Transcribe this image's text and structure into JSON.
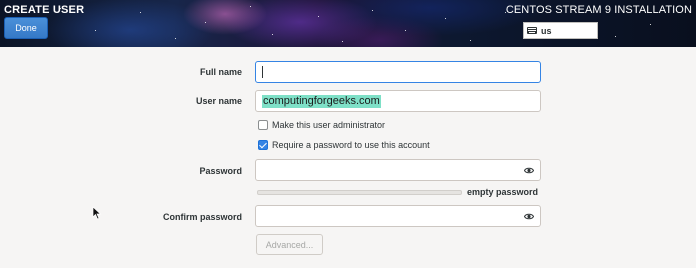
{
  "header": {
    "title": "CREATE USER",
    "done_label": "Done",
    "install_title": "CENTOS STREAM 9 INSTALLATION",
    "keyboard_layout": "us"
  },
  "form": {
    "full_name": {
      "label": "Full name",
      "value": ""
    },
    "user_name": {
      "label": "User name",
      "value": "computingforgeeks.com"
    },
    "admin_checkbox": {
      "label": "Make this user administrator",
      "checked": false
    },
    "require_password_checkbox": {
      "label": "Require a password to use this account",
      "checked": true
    },
    "password": {
      "label": "Password",
      "value": ""
    },
    "password_strength": {
      "text": "empty password",
      "level": 0
    },
    "confirm_password": {
      "label": "Confirm password",
      "value": ""
    },
    "advanced_label": "Advanced..."
  },
  "icons": {
    "eye": "eye-icon",
    "keyboard": "keyboard-icon",
    "cursor": "mouse-pointer-icon"
  },
  "colors": {
    "accent": "#3584e4",
    "highlight": "#7ee0c7"
  }
}
